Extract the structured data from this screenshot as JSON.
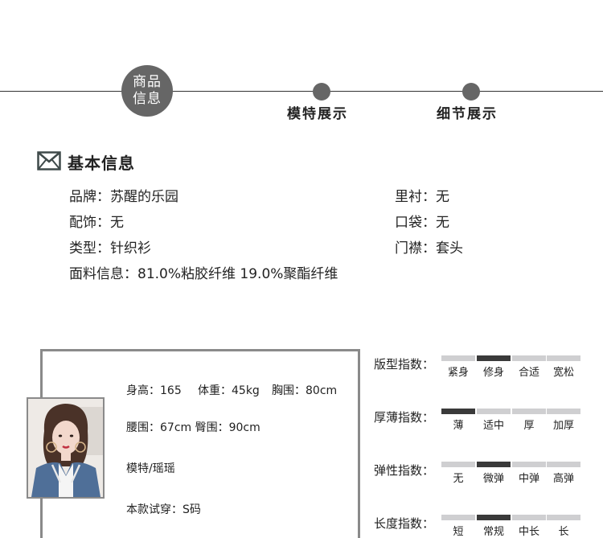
{
  "timeline": {
    "active_step": {
      "line1": "商品",
      "line2": "信息"
    },
    "steps": [
      "模特展示",
      "细节展示"
    ]
  },
  "basic_info": {
    "title": "基本信息",
    "icon": "envelope-icon",
    "brand": "品牌：苏醒的乐园",
    "lining": "里衬：无",
    "accessory": "配饰：无",
    "pocket": "口袋：无",
    "type": "类型：针织衫",
    "placket": "门襟：套头",
    "fabric": "面料信息：81.0%粘胶纤维 19.0%聚酯纤维"
  },
  "model": {
    "height": "身高：165",
    "weight": "体重：45kg",
    "chest": "胸围：80cm",
    "waist_hip": "腰围：67cm  臀围：90cm",
    "name": "模特/瑶瑶",
    "size_tried": "本款试穿：S码"
  },
  "indices": [
    {
      "label": "版型指数：",
      "options": [
        "紧身",
        "修身",
        "合适",
        "宽松"
      ],
      "selected": 1
    },
    {
      "label": "厚薄指数：",
      "options": [
        "薄",
        "适中",
        "厚",
        "加厚"
      ],
      "selected": 0
    },
    {
      "label": "弹性指数：",
      "options": [
        "无",
        "微弹",
        "中弹",
        "高弹"
      ],
      "selected": 1
    },
    {
      "label": "长度指数：",
      "options": [
        "短",
        "常规",
        "中长",
        "长"
      ],
      "selected": 1
    }
  ],
  "colors": {
    "line": "#333333",
    "dot": "#666666",
    "bar": "#cfcfd1",
    "bar_active": "#3a3a3a",
    "border": "#8a8a8a"
  }
}
